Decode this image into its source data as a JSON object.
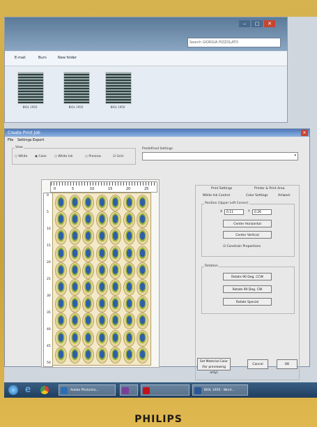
{
  "explorer": {
    "search_placeholder": "Search GIORGIA PIZZOLATO",
    "toolbar": [
      "E-mail",
      "Burn",
      "New folder"
    ],
    "files": [
      "BIOL 1950",
      "BIOL 1950",
      "BIOL 1950"
    ],
    "window_buttons": [
      "‒",
      "□",
      "✕"
    ]
  },
  "dialog": {
    "title": "Create Print Job",
    "menus": [
      "File",
      "Settings",
      "Export"
    ],
    "view": {
      "label": "View",
      "options": [
        "White",
        "Color",
        "White Ink",
        "Preview",
        "Grid"
      ],
      "selected": "Color",
      "grid_checked": true
    },
    "predefined_settings_label": "Predefined Settings",
    "predefined_settings_value": "",
    "ruler_top_ticks": [
      "0",
      "5",
      "10",
      "15",
      "20",
      "25"
    ],
    "ruler_left_ticks": [
      "0",
      "5",
      "10",
      "15",
      "20",
      "25",
      "30",
      "35",
      "40",
      "45",
      "50"
    ],
    "sheet": {
      "columns": 7,
      "rows": 10
    },
    "tabs": [
      "Print Settings",
      "Printer & Print Area",
      "White Ink Control",
      "Color Settings",
      "Artwork"
    ],
    "position": {
      "label": "Position (Upper Left Corner)",
      "x_label": "X",
      "x_value": "0.11",
      "y_label": "Y",
      "y_value": "0.26",
      "center_horizontal": "Center Horizontal",
      "center_vertical": "Center Vertical",
      "constrain_proportions": "Constrain Proportions",
      "constrain_checked": true
    },
    "rotation": {
      "label": "Rotation",
      "ccw": "Rotate 90 Deg. CCW",
      "cw": "Rotate 90 Deg. CW",
      "special": "Rotate Special"
    },
    "set_material_color": "Set Material Color (for previewing only)",
    "cancel": "Cancel",
    "ok": "OK"
  },
  "taskbar": {
    "items": [
      "Adobe Photosho...",
      "OneNote",
      "Adobe Acrobat",
      "Create Print Job",
      "BIOL 1950 - Word..."
    ],
    "colors": [
      "#2a6fb6",
      "#7a3f9b",
      "#c0141c",
      "#3366aa",
      "#2b5797"
    ]
  },
  "monitor": {
    "brand": "PHILIPS"
  }
}
